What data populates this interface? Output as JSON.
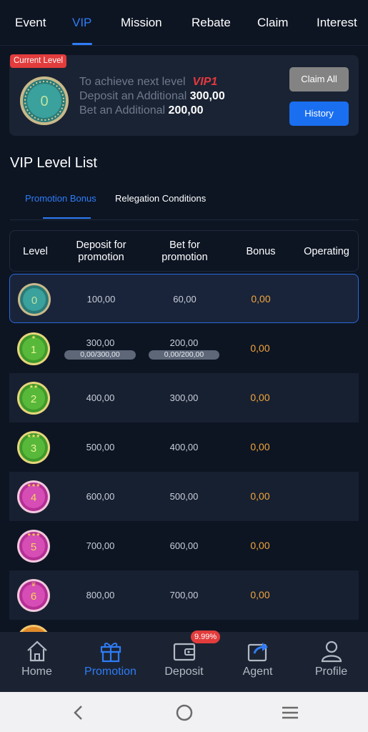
{
  "top_tabs": [
    "Event",
    "VIP",
    "Mission",
    "Rebate",
    "Claim",
    "Interest"
  ],
  "active_tab": "VIP",
  "level_card": {
    "badge": "Current Level",
    "medal_level": "0",
    "line1_text": "To achieve next level",
    "line1_level": "VIP1",
    "line2_text": "Deposit an Additional",
    "line2_value": "300,00",
    "line3_text": "Bet an Additional",
    "line3_value": "200,00",
    "claim_all_label": "Claim All",
    "history_label": "History"
  },
  "section_title": "VIP Level List",
  "sub_tabs": [
    "Promotion Bonus",
    "Relegation Conditions"
  ],
  "active_sub_tab": "Promotion Bonus",
  "table": {
    "headers": [
      "Level",
      "Deposit for promotion",
      "Bet for promotion",
      "Bonus",
      "Operating"
    ],
    "header_lines": {
      "deposit": [
        "Deposit for",
        "promotion"
      ],
      "bet": [
        "Bet for",
        "promotion"
      ]
    },
    "rows": [
      {
        "level": "0",
        "deposit": "100,00",
        "bet": "60,00",
        "bonus": "0,00"
      },
      {
        "level": "1",
        "deposit": "300,00",
        "bet": "200,00",
        "bonus": "0,00",
        "deposit_progress": "0,00/300,00",
        "bet_progress": "0,00/200,00"
      },
      {
        "level": "2",
        "deposit": "400,00",
        "bet": "300,00",
        "bonus": "0,00"
      },
      {
        "level": "3",
        "deposit": "500,00",
        "bet": "400,00",
        "bonus": "0,00"
      },
      {
        "level": "4",
        "deposit": "600,00",
        "bet": "500,00",
        "bonus": "0,00"
      },
      {
        "level": "5",
        "deposit": "700,00",
        "bet": "600,00",
        "bonus": "0,00"
      },
      {
        "level": "6",
        "deposit": "800,00",
        "bet": "700,00",
        "bonus": "0,00"
      }
    ]
  },
  "bottom_nav": [
    {
      "label": "Home",
      "icon": "home-icon"
    },
    {
      "label": "Promotion",
      "icon": "gift-icon"
    },
    {
      "label": "Deposit",
      "icon": "wallet-icon",
      "badge": "9.99%"
    },
    {
      "label": "Agent",
      "icon": "share-icon"
    },
    {
      "label": "Profile",
      "icon": "user-icon"
    }
  ],
  "active_nav": "Promotion",
  "colors": {
    "accent": "#2f7cf6",
    "bonus": "#f3a53a",
    "badge_red": "#e23c3c",
    "background": "#0d1523"
  }
}
